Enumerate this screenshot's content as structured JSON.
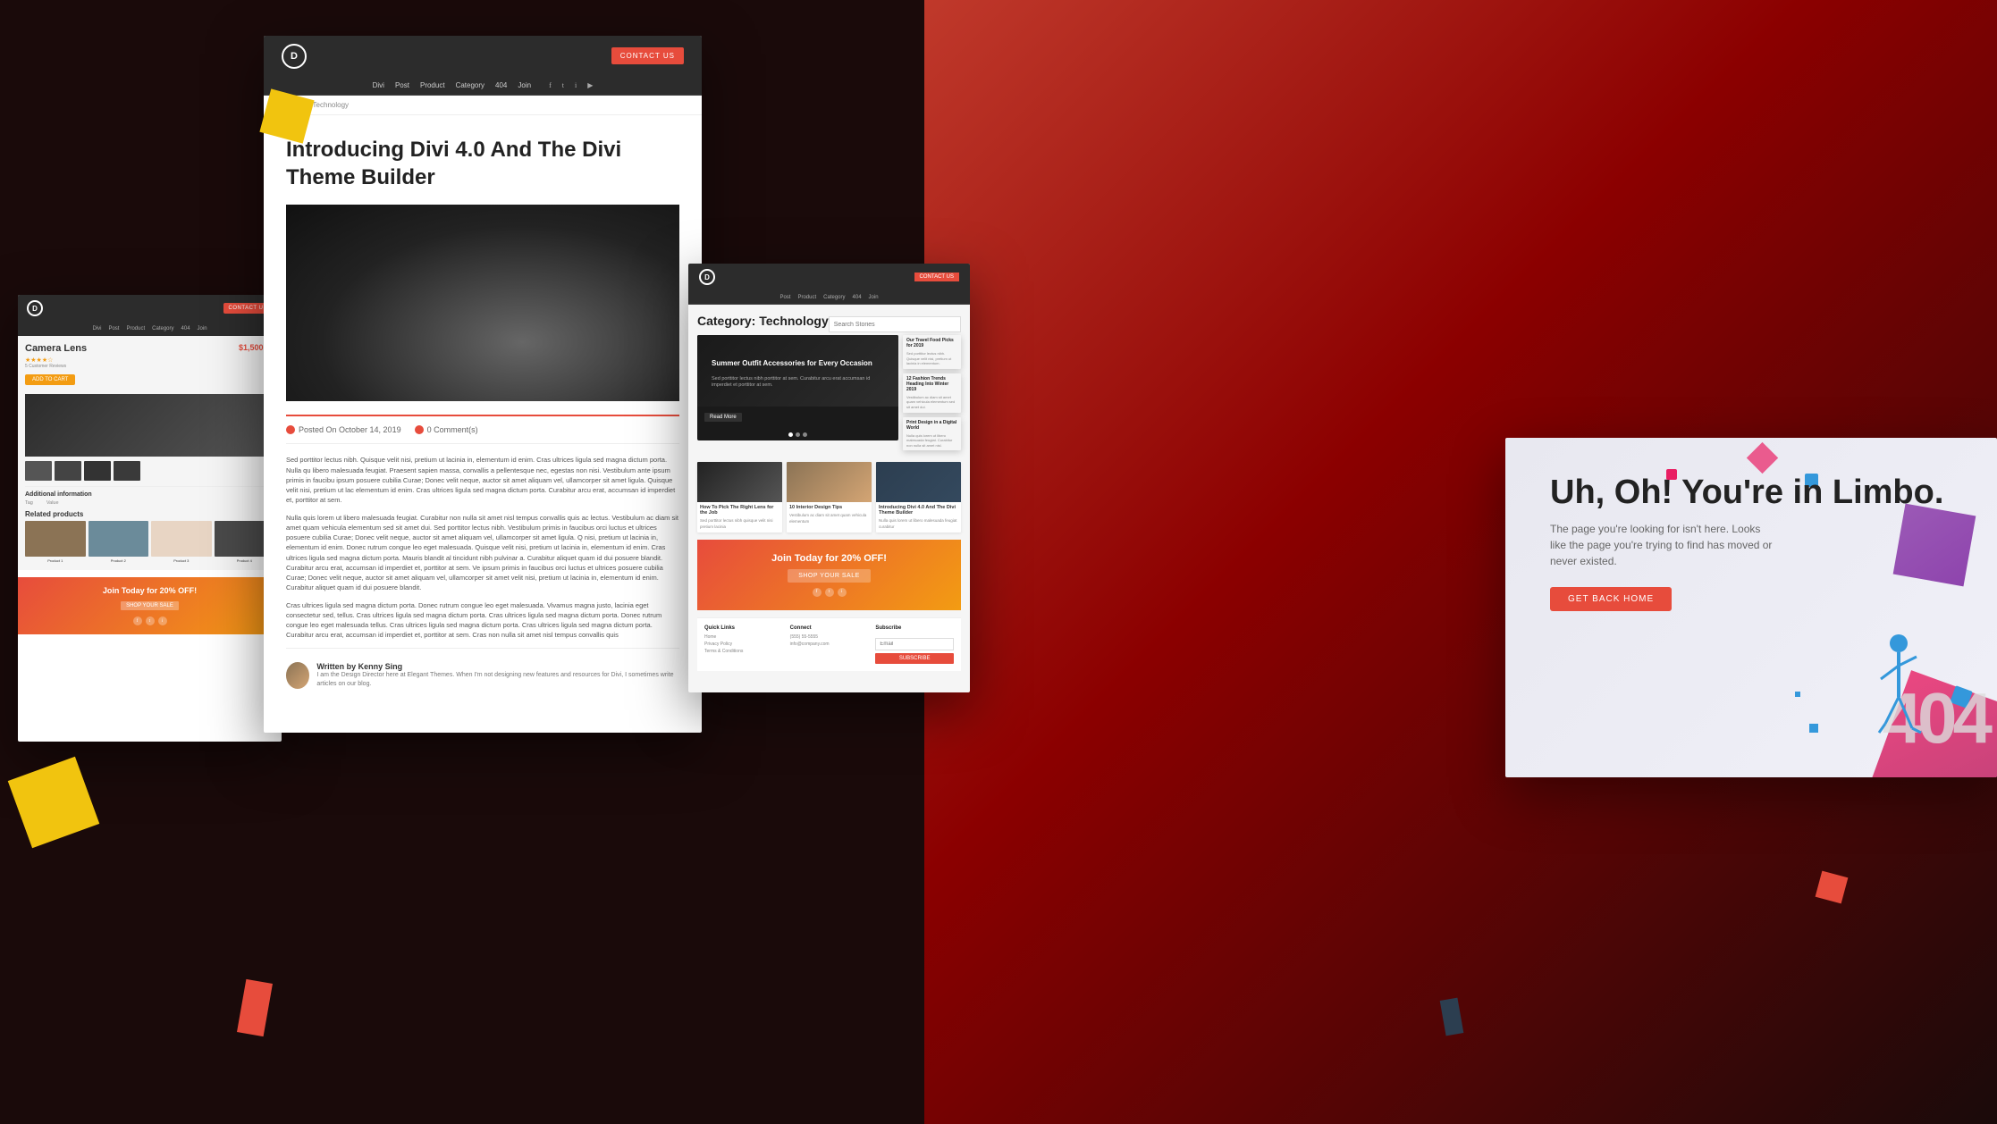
{
  "background": {
    "color": "#1a0a0a"
  },
  "left_panel": {
    "header": {
      "logo": "D",
      "contact_button": "CONTACT US"
    },
    "nav_items": [
      "Divi",
      "Post",
      "Product",
      "Category",
      "404",
      "Join"
    ],
    "product": {
      "title": "Camera Lens",
      "price": "$1,500.00",
      "stars": "★★★★☆",
      "reviews": "5 Customer Reviews",
      "add_to_cart": "ADD TO CART",
      "additional_info_label": "Additional information",
      "related_title": "Related products",
      "join_banner_title": "Join Today for 20% OFF!",
      "shop_sale": "SHOP YOUR SALE"
    }
  },
  "mid_left_panel": {
    "header": {
      "logo": "D",
      "contact_button": "CONTACT US"
    },
    "nav_items": [
      "Divi",
      "Post",
      "Product",
      "Category",
      "404",
      "Join"
    ],
    "breadcrumb": "Divi | Technology",
    "comments_label": "0 Comment(s)",
    "blog": {
      "title": "Introducing Divi 4.0 And The Divi Theme Builder",
      "date": "Posted On October 14, 2019",
      "comments": "0 Comment(s)",
      "body1": "Sed porttitor lectus nibh. Quisque velit nisi, pretium ut lacinia in, elementum id enim. Cras ultrices ligula sed magna dictum porta. Nulla qu libero malesuada feugiat. Praesent sapien massa, convallis a pellentesque nec, egestas non nisi. Vestibulum ante ipsum primis in faucibu ipsum posuere cubilia Curae; Donec velit neque, auctor sit amet aliquam vel, ullamcorper sit amet ligula. Quisque velit nisi, pretium ut lac elementum id enim. Cras ultrices ligula sed magna dictum porta. Curabitur arcu erat, accumsan id imperdiet et, porttitor at sem.",
      "body2": "Nulla quis lorem ut libero malesuada feugiat. Curabitur non nulla sit amet nisl tempus convallis quis ac lectus. Vestibulum ac diam sit amet quam vehicula elementum sed sit amet dui. Sed porttitor lectus nibh. Vestibulum primis in faucibus orci luctus et ultrices posuere cubilia Curae; Donec velit neque, auctor sit amet aliquam vel, ullamcorper sit amet ligula. Q nisi, pretium ut lacinia in, elementum id enim. Donec rutrum congue leo eget malesuada. Quisque velit nisi, pretium ut lacinia in, elementum id enim. Cras ultrices ligula sed magna dictum porta. Mauris blandit al tincidunt nibh pulvinar a. Curabitur aliquet quam id dui posuere blandit. Curabitur arcu erat, accumsan id imperdiet et, porttitor at sem. Ve ipsum primis in faucibus orci luctus et ultrices posuere cubilia Curae; Donec velit neque, auctor sit amet aliquam vel, ullamcorper sit amet velit nisi, pretium ut lacinia in, elementum id enim. Curabitur aliquet quam id dui posuere blandit.",
      "body3": "Cras ultrices ligula sed magna dictum porta. Donec rutrum congue leo eget malesuada. Vivamus magna justo, lacinia eget consectetur sed, tellus. Cras ultrices ligula sed magna dictum porta. Cras ultrices ligula sed magna dictum porta. Donec rutrum congue leo eget malesuada tellus. Cras ultrices ligula sed magna dictum porta. Cras ultrices ligula sed magna dictum porta. Curabitur arcu erat, accumsan id imperdiet et, porttitor at sem. Cras non nulla sit amet nisl tempus convallis quis",
      "author_section": {
        "written_by": "Written by Kenny Sing",
        "bio": "I am the Design Director here at Elegant Themes. When I'm not designing new features and resources for Divi, I sometimes write articles on our blog."
      }
    }
  },
  "category_panel": {
    "header": {
      "logo": "D",
      "contact_button": "CONTACT US"
    },
    "nav_items": [
      "Post",
      "Product",
      "Category",
      "404",
      "Join"
    ],
    "title": "Category: Technology",
    "search_placeholder": "Search Stories",
    "featured_article": {
      "title": "Summer Outfit Accessories for Every Occasion",
      "read_more": "Read More",
      "dots": [
        true,
        false,
        false
      ]
    },
    "sidebar": {
      "title1": "Our Travel Food Picks for 2019",
      "text1": "Sed porttitor lectus nibh. Quisque velit nisi, pretium ut lacinia in elementum.",
      "title2": "12 Fashion Trends Heading Into Winter 2019",
      "text2": "Vestibulum ac diam sit amet quam vehicula elementum sed sit amet dui.",
      "title3": "Print Design in a Digital World",
      "text3": "Nulla quis lorem ut libero malesuada feugiat. Curabitur non nulla sit amet nisl."
    },
    "articles": [
      {
        "title": "How To Pick The Right Lens for the Job",
        "type": "lens",
        "text": "Sed porttitor lectus nibh quisque velit nisi pretium lacinia"
      },
      {
        "title": "10 Interior Design Tips",
        "type": "food",
        "text": "Vestibulum ac diam sit amet quam vehicula elementum"
      },
      {
        "title": "Introducing Divi 4.0 And The Divi Theme Builder",
        "type": "tech",
        "text": "Nulla quis lorem ut libero malesuada feugiat curabitur"
      }
    ],
    "join_banner": {
      "title": "Join Today for 20% OFF!",
      "button": "SHOP YOUR SALE"
    },
    "footer": {
      "quick_links_title": "Quick Links",
      "quick_links": [
        "Home",
        "Privacy Policy",
        "Terms & Conditions"
      ],
      "connect_title": "Connect",
      "connect_links": [
        "(555) 55-5555",
        "info@company.com"
      ],
      "subscribe_title": "Subscribe",
      "email_placeholder": "Email",
      "subscribe_button": "SUBSCRIBE"
    }
  },
  "limbo_panel": {
    "title": "Uh, Oh! You're in Limbo.",
    "subtitle": "The page you're looking for isn't here. Looks like the page you're trying to find has moved or never existed.",
    "button": "GET BACK HOME",
    "figure": "404"
  }
}
